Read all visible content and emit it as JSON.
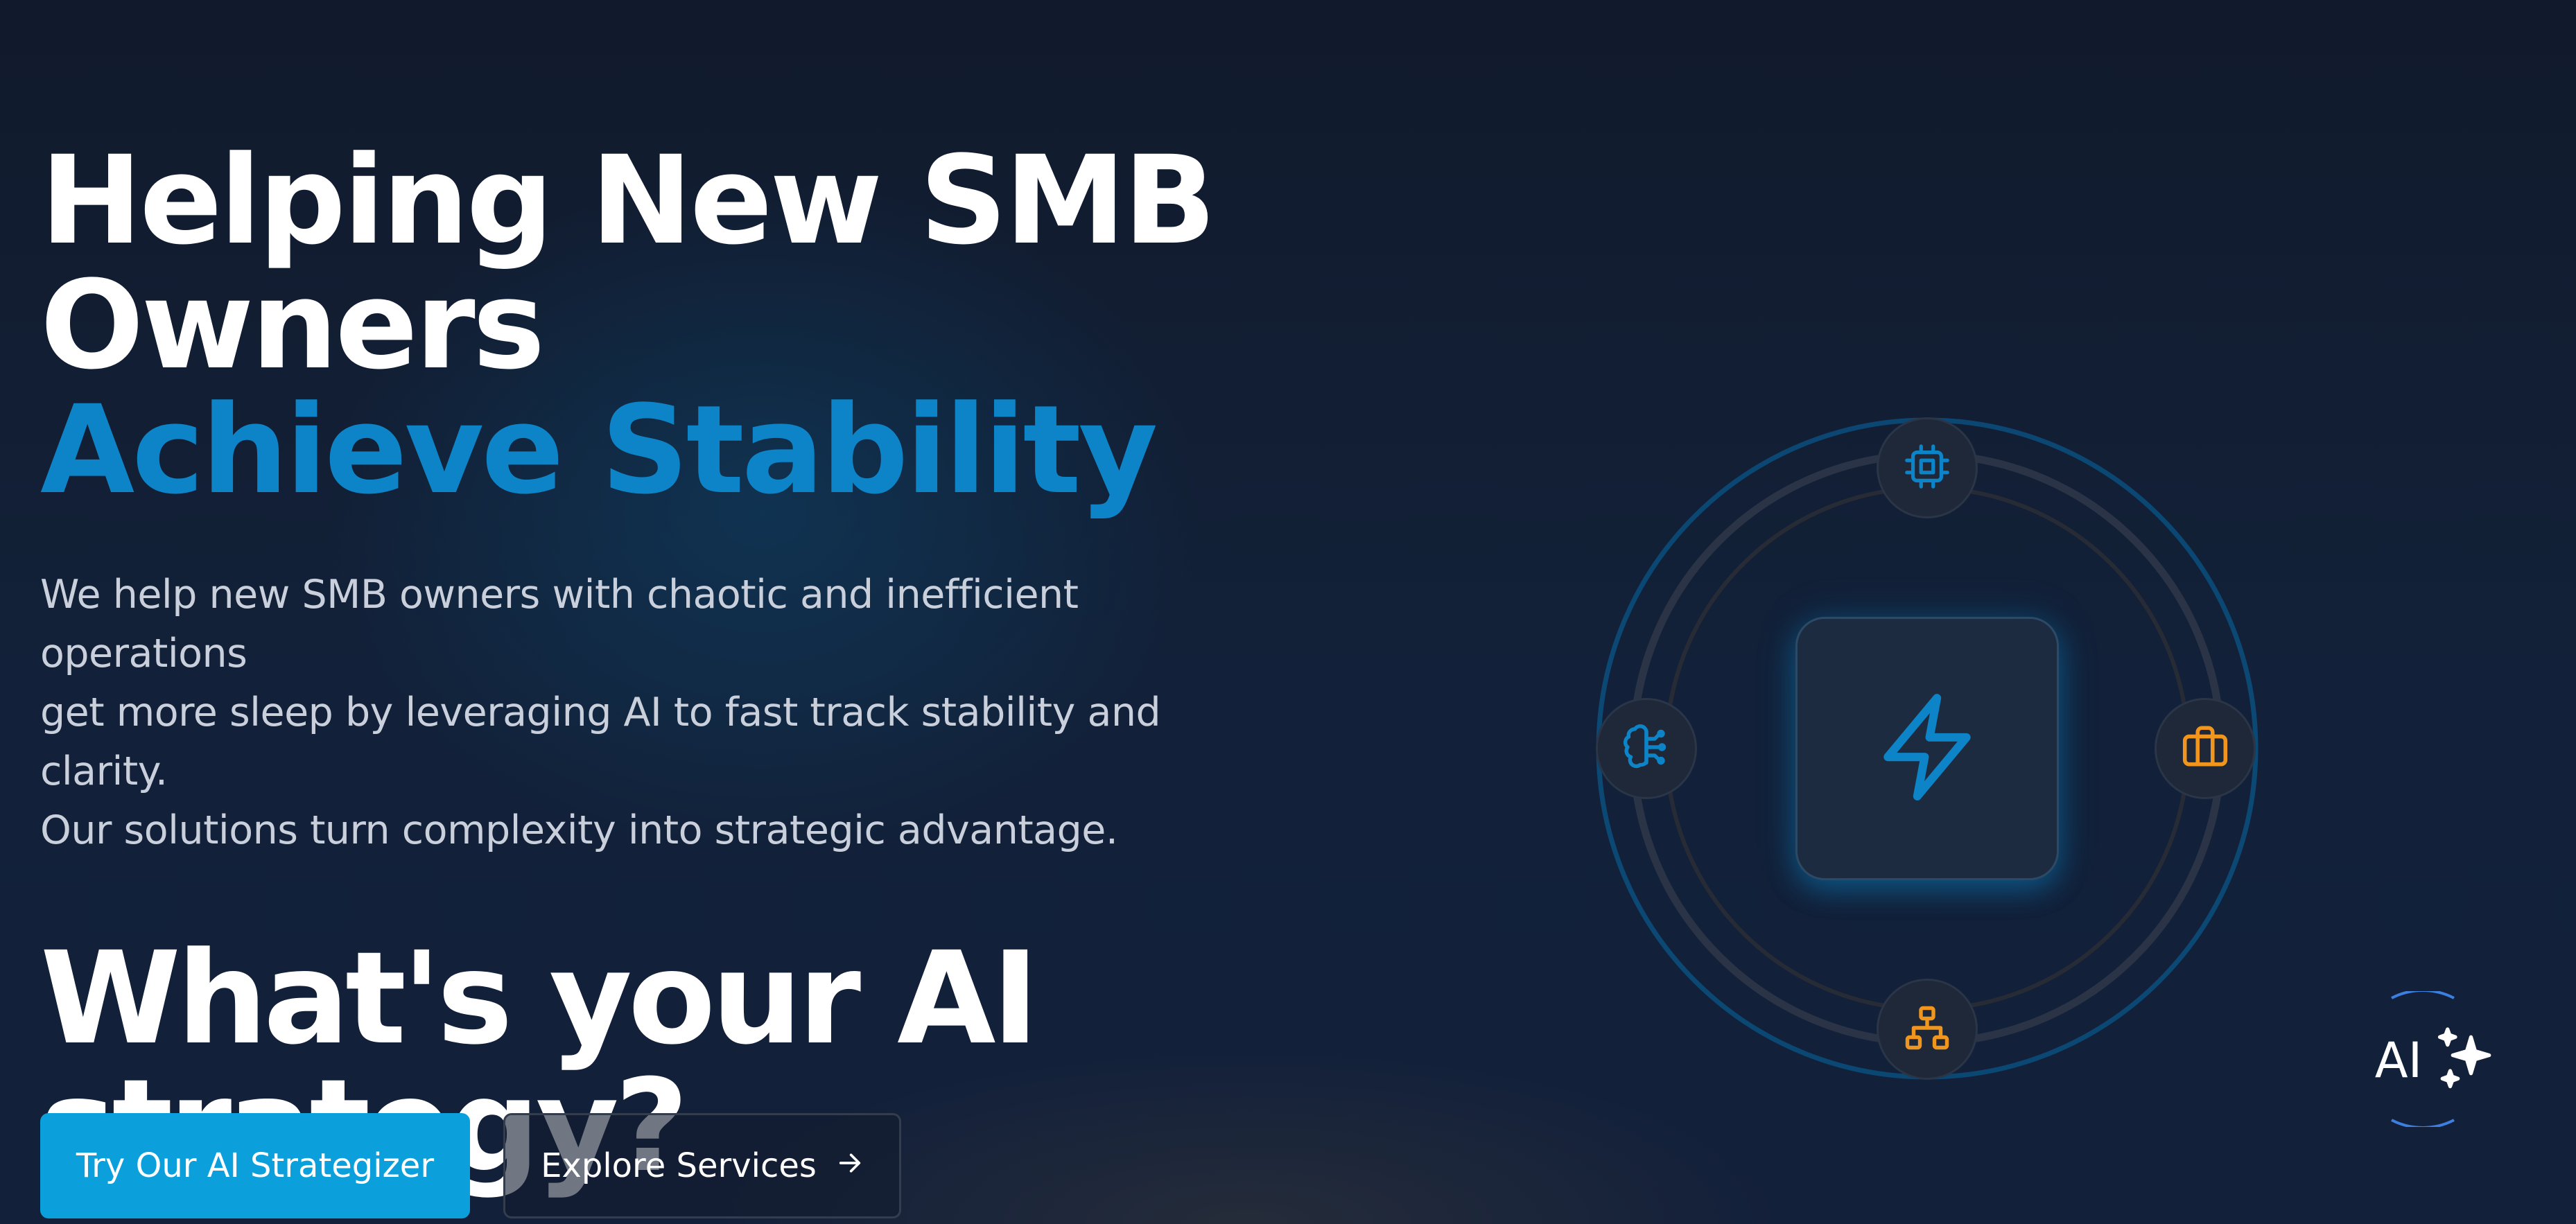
{
  "hero": {
    "headline_line1": "Helping New SMB",
    "headline_line2": "Owners",
    "headline_accent": "Achieve Stability",
    "subtext_line1": "We help new SMB owners with chaotic and inefficient operations",
    "subtext_line2": "get more sleep by leveraging AI to fast track stability and clarity.",
    "subtext_line3": "Our solutions turn complexity into strategic advantage.",
    "strategy_line1": "What's your AI",
    "strategy_line2": "strategy?"
  },
  "buttons": {
    "primary_label": "Try Our AI Strategizer",
    "secondary_label": "Explore Services",
    "secondary_icon": "arrow-right-icon"
  },
  "diagram": {
    "center_icon": "lightning-bolt-icon",
    "nodes": {
      "top": "cpu-chip-icon",
      "right": "briefcase-icon",
      "bottom": "sitemap-icon",
      "left": "brain-icon"
    },
    "colors": {
      "accent_blue": "#0d84c7",
      "accent_orange": "#f0961e"
    }
  },
  "ai_badge": {
    "label": "AI",
    "icon": "sparkles-icon"
  }
}
